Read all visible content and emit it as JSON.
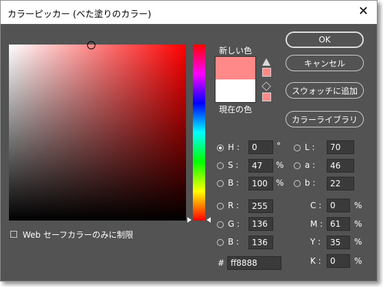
{
  "window": {
    "title": "カラーピッカー (べた塗りのカラー)",
    "close_label": "✕"
  },
  "colors": {
    "new": "#ff8888",
    "current": "#ffffff",
    "hue_value": "#ff0000"
  },
  "labels": {
    "new": "新しい色",
    "current": "現在の色"
  },
  "buttons": {
    "ok": "OK",
    "cancel": "キャンセル",
    "add_swatch": "スウォッチに追加",
    "libraries": "カラーライブラリ"
  },
  "hsb": [
    {
      "label": "H :",
      "value": "0",
      "unit": "°"
    },
    {
      "label": "S :",
      "value": "47",
      "unit": "%"
    },
    {
      "label": "B :",
      "value": "100",
      "unit": "%"
    }
  ],
  "lab": [
    {
      "label": "L :",
      "value": "70"
    },
    {
      "label": "a :",
      "value": "46"
    },
    {
      "label": "b :",
      "value": "22"
    }
  ],
  "rgb": [
    {
      "label": "R :",
      "value": "255"
    },
    {
      "label": "G :",
      "value": "136"
    },
    {
      "label": "B :",
      "value": "136"
    }
  ],
  "cmyk": [
    {
      "label": "C :",
      "value": "0",
      "unit": "%"
    },
    {
      "label": "M :",
      "value": "61",
      "unit": "%"
    },
    {
      "label": "Y :",
      "value": "35",
      "unit": "%"
    },
    {
      "label": "K :",
      "value": "0",
      "unit": "%"
    }
  ],
  "hex": {
    "label": "#",
    "value": "ff8888"
  },
  "web_safe": {
    "label": "Web セーフカラーのみに制限"
  },
  "icons": {
    "warning": "gamut-warning-icon",
    "web": "web-safe-cube-icon"
  }
}
